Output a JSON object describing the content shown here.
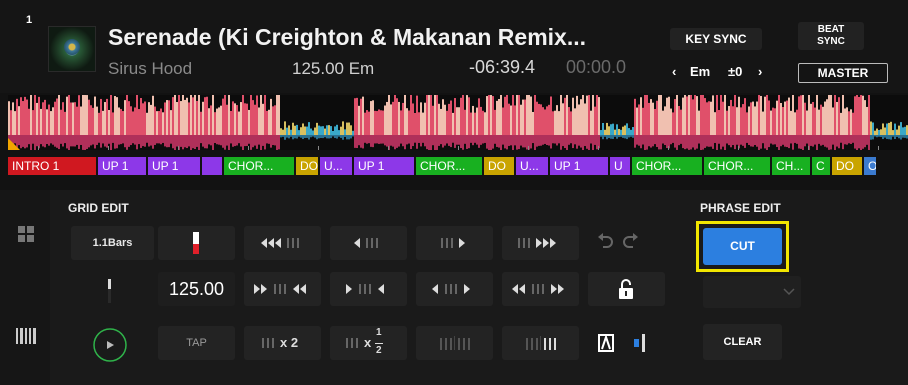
{
  "deck": {
    "number": "1",
    "title": "Serenade (Ki Creighton & Makanan Remix...",
    "artist": "Sirus Hood",
    "bpm_key": "125.00 Em",
    "remaining": "-06:39.4",
    "elapsed": "00:00.0"
  },
  "sync": {
    "key_sync": "KEY SYNC",
    "beat_sync": [
      "BEAT",
      "SYNC"
    ],
    "key_prev": "‹",
    "key": "Em",
    "key_offset": "±0",
    "key_next": "›",
    "master": "MASTER"
  },
  "phrases": [
    {
      "label": "INTRO 1",
      "color": "#d01820"
    },
    {
      "label": "UP 1",
      "color": "#8d38e8"
    },
    {
      "label": "UP 1",
      "color": "#8d38e8"
    },
    {
      "label": "",
      "color": "#8d38e8"
    },
    {
      "label": "CHOR...",
      "color": "#18b020"
    },
    {
      "label": "DO",
      "color": "#c9a400"
    },
    {
      "label": "U...",
      "color": "#8d38e8"
    },
    {
      "label": "UP 1",
      "color": "#8d38e8"
    },
    {
      "label": "CHOR...",
      "color": "#18b020"
    },
    {
      "label": "DO",
      "color": "#c9a400"
    },
    {
      "label": "U...",
      "color": "#8d38e8"
    },
    {
      "label": "UP 1",
      "color": "#8d38e8"
    },
    {
      "label": "U",
      "color": "#8d38e8"
    },
    {
      "label": "CHOR...",
      "color": "#18b020"
    },
    {
      "label": "CHOR...",
      "color": "#18b020"
    },
    {
      "label": "CH...",
      "color": "#18b020"
    },
    {
      "label": "C",
      "color": "#18b020"
    },
    {
      "label": "DO",
      "color": "#c9a400"
    },
    {
      "label": "O",
      "color": "#3b7bd0"
    }
  ],
  "grid_edit": {
    "title": "GRID EDIT",
    "bars": "1.1Bars",
    "bpm_value": "125.00",
    "tap": "TAP",
    "x2": "x 2",
    "x_half_num": "1",
    "x_half_den": "2"
  },
  "phrase_edit": {
    "title": "PHRASE EDIT",
    "cut": "CUT",
    "clear": "CLEAR"
  },
  "colors": {
    "cut_blue": "#2c7fe0",
    "highlight_yellow": "#f2e600",
    "play_green": "#2fb34a"
  }
}
